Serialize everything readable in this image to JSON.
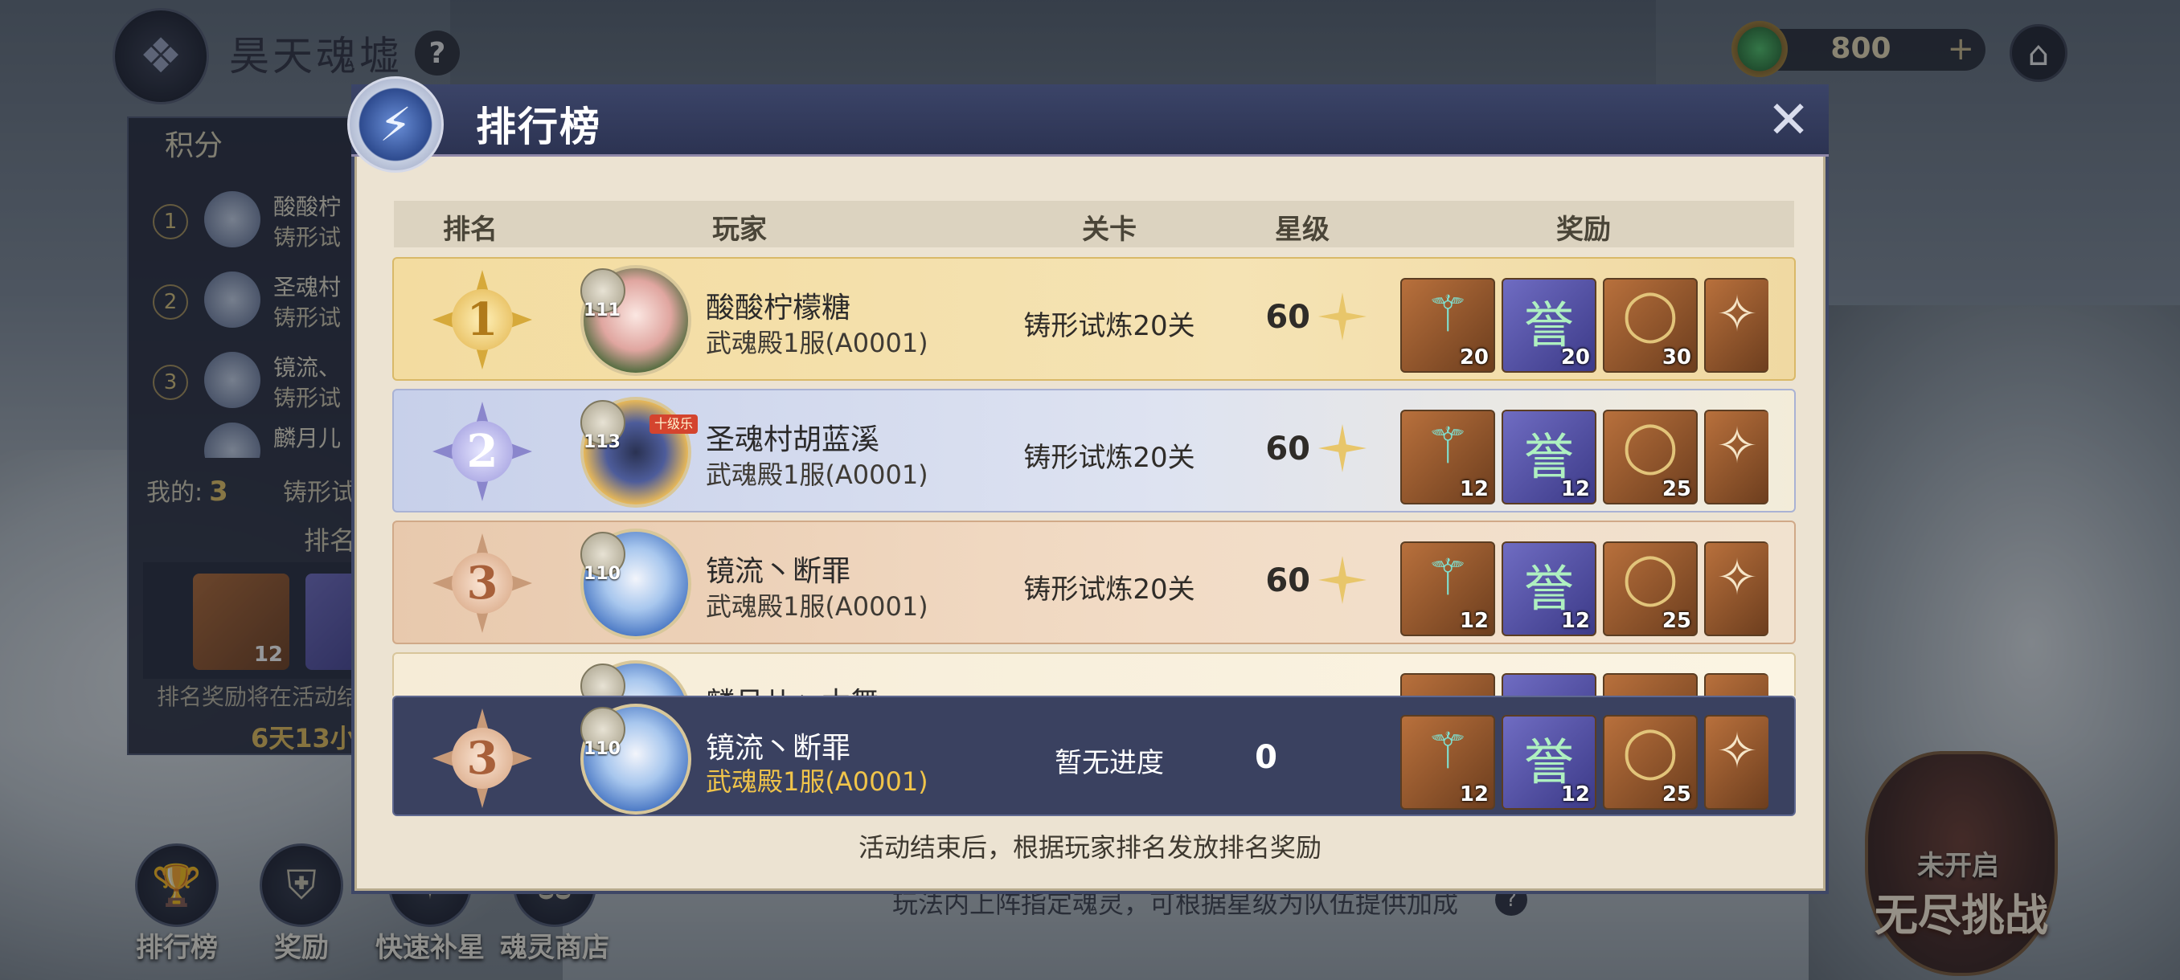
{
  "top_bar": {
    "title": "昊天魂墟",
    "help_label": "?",
    "currency_value": "800",
    "currency_add": "+",
    "home_icon": "home-icon"
  },
  "left_panel": {
    "header": "积分",
    "entries": [
      {
        "rank": "1",
        "name": "酸酸柠",
        "sub": "铸形试"
      },
      {
        "rank": "2",
        "name": "圣魂村",
        "sub": "铸形试"
      },
      {
        "rank": "3",
        "name": "镜流、",
        "sub": "铸形试"
      },
      {
        "rank": "",
        "name": "麟月儿",
        "sub": ""
      }
    ],
    "mine_label": "我的:",
    "mine_value": "3",
    "mine_sub": "铸形试",
    "rank_reward_label": "排名",
    "reward_qty": "12",
    "note": "排名奖励将在活动结",
    "timer": "6天13小"
  },
  "bottom_buttons": [
    {
      "label": "排行榜",
      "icon": "trophy-icon"
    },
    {
      "label": "奖励",
      "icon": "helmet-icon"
    },
    {
      "label": "快速补星",
      "icon": "star-refill-icon"
    },
    {
      "label": "魂灵商店",
      "icon": "shop-icon"
    }
  ],
  "background_tip": "玩法内上阵指定魂灵，可根据星级为队伍提供加成",
  "endless": {
    "status": "未开启",
    "title": "无尽挑战"
  },
  "modal": {
    "title": "排行榜",
    "emblem": "⚡",
    "columns": [
      "排名",
      "玩家",
      "关卡",
      "星级",
      "奖励"
    ],
    "rows": [
      {
        "rank": "1",
        "level": "111",
        "name": "酸酸柠檬糖",
        "server": "武魂殿1服(A0001)",
        "stage": "铸形试炼20关",
        "stars": "60",
        "rewards": [
          "20",
          "20",
          "30",
          ""
        ]
      },
      {
        "rank": "2",
        "level": "113",
        "tag": "十级乐",
        "name": "圣魂村胡蓝溪",
        "server": "武魂殿1服(A0001)",
        "stage": "铸形试炼20关",
        "stars": "60",
        "rewards": [
          "12",
          "12",
          "25",
          ""
        ]
      },
      {
        "rank": "3",
        "level": "110",
        "name": "镜流丶断罪",
        "server": "武魂殿1服(A0001)",
        "stage": "铸形试炼20关",
        "stars": "60",
        "rewards": [
          "12",
          "12",
          "25",
          ""
        ]
      },
      {
        "rank": "",
        "level": "",
        "name": "麟月儿丶木舞",
        "server": "",
        "stage": "",
        "stars": "",
        "rewards": [
          "",
          "",
          "",
          ""
        ]
      }
    ],
    "my_row": {
      "rank": "3",
      "level": "110",
      "name": "镜流丶断罪",
      "server": "武魂殿1服(A0001)",
      "stage": "暂无进度",
      "stars": "0",
      "rewards": [
        "12",
        "12",
        "25",
        ""
      ]
    },
    "footer": "活动结束后，根据玩家排名发放排名奖励",
    "reward_icons": [
      "staff-icon",
      "badge-icon",
      "ring-icon",
      "bag-icon"
    ],
    "reward_badge_char": "誉"
  }
}
